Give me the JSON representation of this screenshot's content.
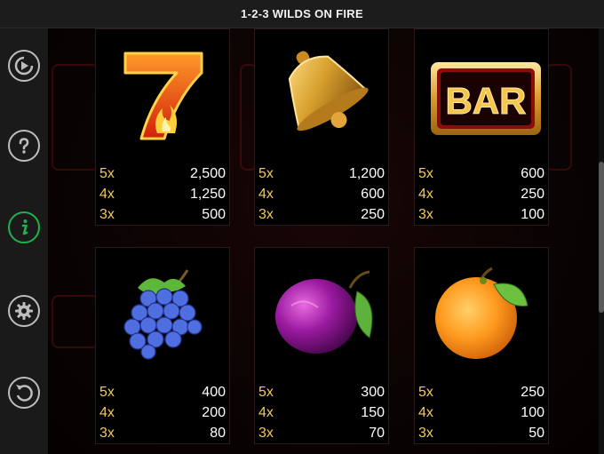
{
  "window": {
    "title": "1-2-3 WILDS ON FIRE"
  },
  "sidebar": {
    "buttons": [
      {
        "name": "autoplay",
        "icon": "play-circle-icon"
      },
      {
        "name": "help",
        "icon": "question-icon"
      },
      {
        "name": "info",
        "icon": "info-icon",
        "active": true
      },
      {
        "name": "settings",
        "icon": "gear-icon"
      },
      {
        "name": "back",
        "icon": "back-arrow-icon"
      }
    ]
  },
  "colors": {
    "multiplier": "#f2c95c",
    "value": "#ffffff",
    "active": "#22b14c",
    "icon": "#bdbdbd"
  },
  "paytable": [
    {
      "symbol": "seven",
      "icon": "seven-icon",
      "rows": [
        {
          "mult": "5x",
          "value": "2,500"
        },
        {
          "mult": "4x",
          "value": "1,250"
        },
        {
          "mult": "3x",
          "value": "500"
        }
      ]
    },
    {
      "symbol": "bell",
      "icon": "bell-icon",
      "rows": [
        {
          "mult": "5x",
          "value": "1,200"
        },
        {
          "mult": "4x",
          "value": "600"
        },
        {
          "mult": "3x",
          "value": "250"
        }
      ]
    },
    {
      "symbol": "bar",
      "icon": "bar-icon",
      "label": "BAR",
      "rows": [
        {
          "mult": "5x",
          "value": "600"
        },
        {
          "mult": "4x",
          "value": "250"
        },
        {
          "mult": "3x",
          "value": "100"
        }
      ]
    },
    {
      "symbol": "grapes",
      "icon": "grapes-icon",
      "rows": [
        {
          "mult": "5x",
          "value": "400"
        },
        {
          "mult": "4x",
          "value": "200"
        },
        {
          "mult": "3x",
          "value": "80"
        }
      ]
    },
    {
      "symbol": "plum",
      "icon": "plum-icon",
      "rows": [
        {
          "mult": "5x",
          "value": "300"
        },
        {
          "mult": "4x",
          "value": "150"
        },
        {
          "mult": "3x",
          "value": "70"
        }
      ]
    },
    {
      "symbol": "orange",
      "icon": "orange-icon",
      "rows": [
        {
          "mult": "5x",
          "value": "250"
        },
        {
          "mult": "4x",
          "value": "100"
        },
        {
          "mult": "3x",
          "value": "50"
        }
      ]
    }
  ]
}
